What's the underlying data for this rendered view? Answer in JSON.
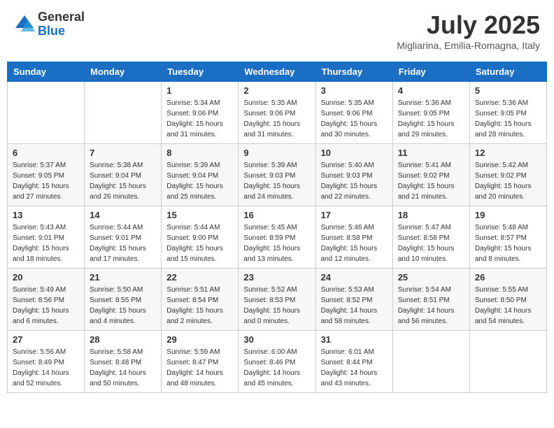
{
  "header": {
    "logo": {
      "general": "General",
      "blue": "Blue"
    },
    "title": "July 2025",
    "location": "Migliarina, Emilia-Romagna, Italy"
  },
  "weekdays": [
    "Sunday",
    "Monday",
    "Tuesday",
    "Wednesday",
    "Thursday",
    "Friday",
    "Saturday"
  ],
  "weeks": [
    [
      {
        "day": null
      },
      {
        "day": null
      },
      {
        "day": 1,
        "sunrise": "5:34 AM",
        "sunset": "9:06 PM",
        "daylight": "15 hours and 31 minutes."
      },
      {
        "day": 2,
        "sunrise": "5:35 AM",
        "sunset": "9:06 PM",
        "daylight": "15 hours and 31 minutes."
      },
      {
        "day": 3,
        "sunrise": "5:35 AM",
        "sunset": "9:06 PM",
        "daylight": "15 hours and 30 minutes."
      },
      {
        "day": 4,
        "sunrise": "5:36 AM",
        "sunset": "9:05 PM",
        "daylight": "15 hours and 29 minutes."
      },
      {
        "day": 5,
        "sunrise": "5:36 AM",
        "sunset": "9:05 PM",
        "daylight": "15 hours and 28 minutes."
      }
    ],
    [
      {
        "day": 6,
        "sunrise": "5:37 AM",
        "sunset": "9:05 PM",
        "daylight": "15 hours and 27 minutes."
      },
      {
        "day": 7,
        "sunrise": "5:38 AM",
        "sunset": "9:04 PM",
        "daylight": "15 hours and 26 minutes."
      },
      {
        "day": 8,
        "sunrise": "5:39 AM",
        "sunset": "9:04 PM",
        "daylight": "15 hours and 25 minutes."
      },
      {
        "day": 9,
        "sunrise": "5:39 AM",
        "sunset": "9:03 PM",
        "daylight": "15 hours and 24 minutes."
      },
      {
        "day": 10,
        "sunrise": "5:40 AM",
        "sunset": "9:03 PM",
        "daylight": "15 hours and 22 minutes."
      },
      {
        "day": 11,
        "sunrise": "5:41 AM",
        "sunset": "9:02 PM",
        "daylight": "15 hours and 21 minutes."
      },
      {
        "day": 12,
        "sunrise": "5:42 AM",
        "sunset": "9:02 PM",
        "daylight": "15 hours and 20 minutes."
      }
    ],
    [
      {
        "day": 13,
        "sunrise": "5:43 AM",
        "sunset": "9:01 PM",
        "daylight": "15 hours and 18 minutes."
      },
      {
        "day": 14,
        "sunrise": "5:44 AM",
        "sunset": "9:01 PM",
        "daylight": "15 hours and 17 minutes."
      },
      {
        "day": 15,
        "sunrise": "5:44 AM",
        "sunset": "9:00 PM",
        "daylight": "15 hours and 15 minutes."
      },
      {
        "day": 16,
        "sunrise": "5:45 AM",
        "sunset": "8:59 PM",
        "daylight": "15 hours and 13 minutes."
      },
      {
        "day": 17,
        "sunrise": "5:46 AM",
        "sunset": "8:58 PM",
        "daylight": "15 hours and 12 minutes."
      },
      {
        "day": 18,
        "sunrise": "5:47 AM",
        "sunset": "8:58 PM",
        "daylight": "15 hours and 10 minutes."
      },
      {
        "day": 19,
        "sunrise": "5:48 AM",
        "sunset": "8:57 PM",
        "daylight": "15 hours and 8 minutes."
      }
    ],
    [
      {
        "day": 20,
        "sunrise": "5:49 AM",
        "sunset": "8:56 PM",
        "daylight": "15 hours and 6 minutes."
      },
      {
        "day": 21,
        "sunrise": "5:50 AM",
        "sunset": "8:55 PM",
        "daylight": "15 hours and 4 minutes."
      },
      {
        "day": 22,
        "sunrise": "5:51 AM",
        "sunset": "8:54 PM",
        "daylight": "15 hours and 2 minutes."
      },
      {
        "day": 23,
        "sunrise": "5:52 AM",
        "sunset": "8:53 PM",
        "daylight": "15 hours and 0 minutes."
      },
      {
        "day": 24,
        "sunrise": "5:53 AM",
        "sunset": "8:52 PM",
        "daylight": "14 hours and 58 minutes."
      },
      {
        "day": 25,
        "sunrise": "5:54 AM",
        "sunset": "8:51 PM",
        "daylight": "14 hours and 56 minutes."
      },
      {
        "day": 26,
        "sunrise": "5:55 AM",
        "sunset": "8:50 PM",
        "daylight": "14 hours and 54 minutes."
      }
    ],
    [
      {
        "day": 27,
        "sunrise": "5:56 AM",
        "sunset": "8:49 PM",
        "daylight": "14 hours and 52 minutes."
      },
      {
        "day": 28,
        "sunrise": "5:58 AM",
        "sunset": "8:48 PM",
        "daylight": "14 hours and 50 minutes."
      },
      {
        "day": 29,
        "sunrise": "5:59 AM",
        "sunset": "8:47 PM",
        "daylight": "14 hours and 48 minutes."
      },
      {
        "day": 30,
        "sunrise": "6:00 AM",
        "sunset": "8:46 PM",
        "daylight": "14 hours and 45 minutes."
      },
      {
        "day": 31,
        "sunrise": "6:01 AM",
        "sunset": "8:44 PM",
        "daylight": "14 hours and 43 minutes."
      },
      {
        "day": null
      },
      {
        "day": null
      }
    ]
  ],
  "labels": {
    "sunrise_prefix": "Sunrise: ",
    "sunset_prefix": "Sunset: ",
    "daylight_prefix": "Daylight: "
  }
}
